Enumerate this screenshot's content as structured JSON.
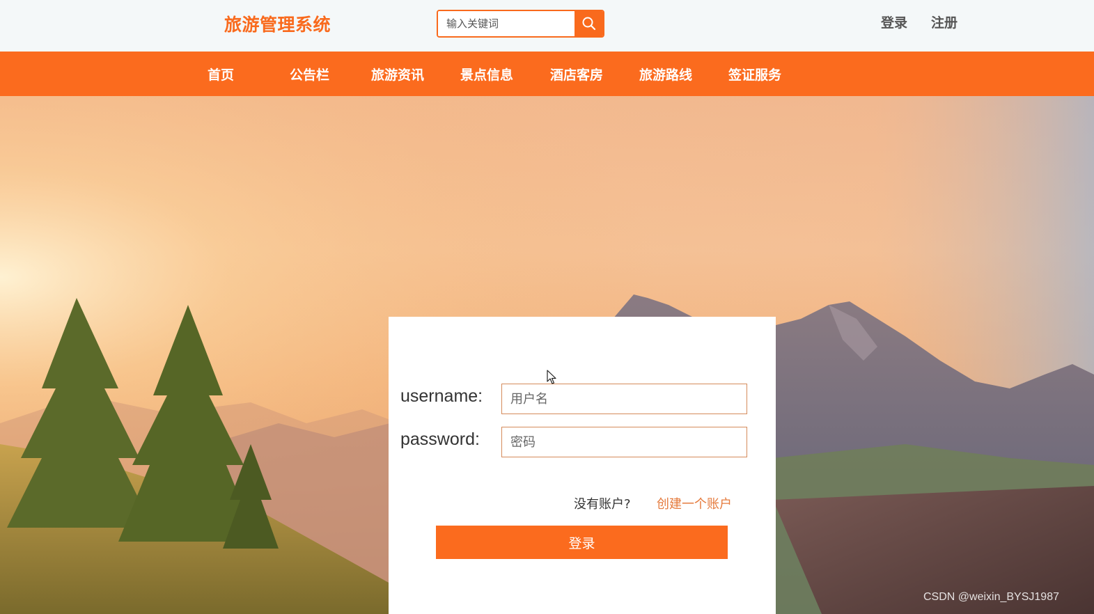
{
  "header": {
    "logo": "旅游管理系统",
    "search_placeholder": "输入关键词",
    "search_icon": "search-icon",
    "login_link": "登录",
    "register_link": "注册"
  },
  "nav": {
    "items": [
      {
        "label": "首页"
      },
      {
        "label": "公告栏"
      },
      {
        "label": "旅游资讯"
      },
      {
        "label": "景点信息"
      },
      {
        "label": "酒店客房"
      },
      {
        "label": "旅游路线"
      },
      {
        "label": "签证服务"
      }
    ]
  },
  "login": {
    "username_label": "username:",
    "username_placeholder": "用户名",
    "password_label": "password:",
    "password_placeholder": "密码",
    "no_account_text": "没有账户?",
    "create_account_link": "创建一个账户",
    "submit_label": "登录"
  },
  "watermark": "CSDN @weixin_BYSJ1987",
  "colors": {
    "accent": "#fb6b1e",
    "logo": "#f96a1d",
    "link": "#e57a3c",
    "header_bg": "#f4f8f9"
  }
}
